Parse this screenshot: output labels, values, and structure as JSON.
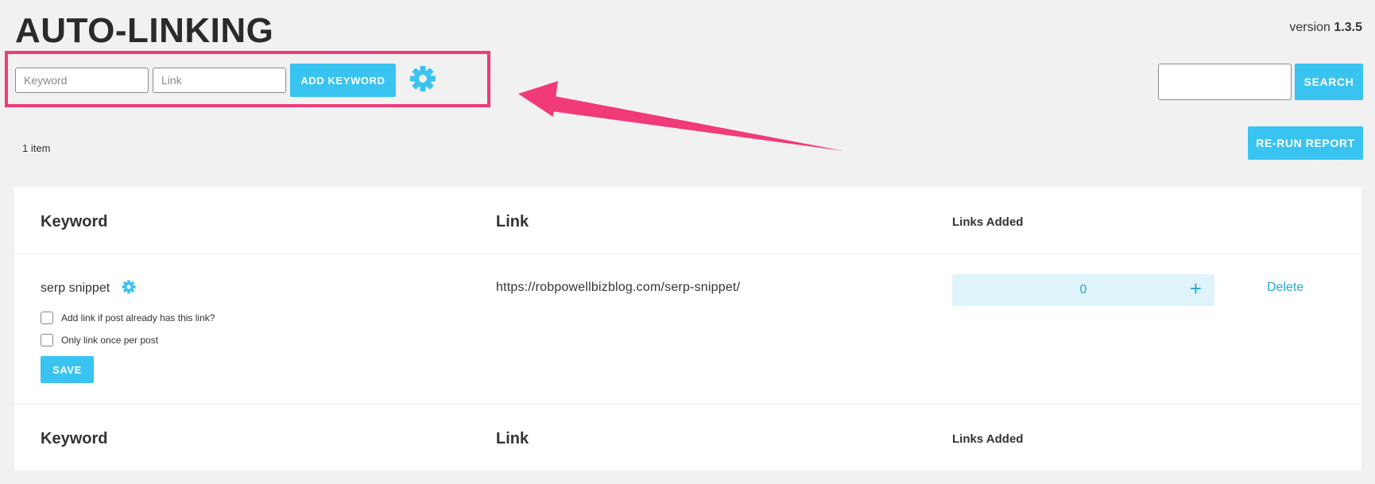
{
  "header": {
    "title": "AUTO-LINKING",
    "version_prefix": "version",
    "version_number": "1.3.5"
  },
  "add_form": {
    "keyword_placeholder": "Keyword",
    "link_placeholder": "Link",
    "add_button": "ADD KEYWORD",
    "settings_icon": "gear-icon"
  },
  "search": {
    "value": "",
    "button": "SEARCH"
  },
  "summary": {
    "count": "1 item",
    "rerun_button": "RE-RUN REPORT"
  },
  "table": {
    "columns": [
      "Keyword",
      "Link",
      "Links Added"
    ],
    "rows": [
      {
        "keyword": "serp snippet",
        "settings_icon": "gear-icon",
        "option_1": "Add link if post already has this link?",
        "option_1_checked": false,
        "option_2": "Only link once per post",
        "option_2_checked": false,
        "save_button": "SAVE",
        "link": "https://robpowellbizblog.com/serp-snippet/",
        "links_added": "0",
        "increment_icon": "plus-icon",
        "delete": "Delete"
      }
    ],
    "footer_columns": [
      "Keyword",
      "Link",
      "Links Added"
    ]
  },
  "colors": {
    "accent": "#39c3f0",
    "highlight_border": "#f03a7a",
    "arrow": "#f03a7a",
    "link_text": "#2aa6d4",
    "counter_bg": "#dff3fb",
    "page_bg": "#f1f1f1"
  }
}
